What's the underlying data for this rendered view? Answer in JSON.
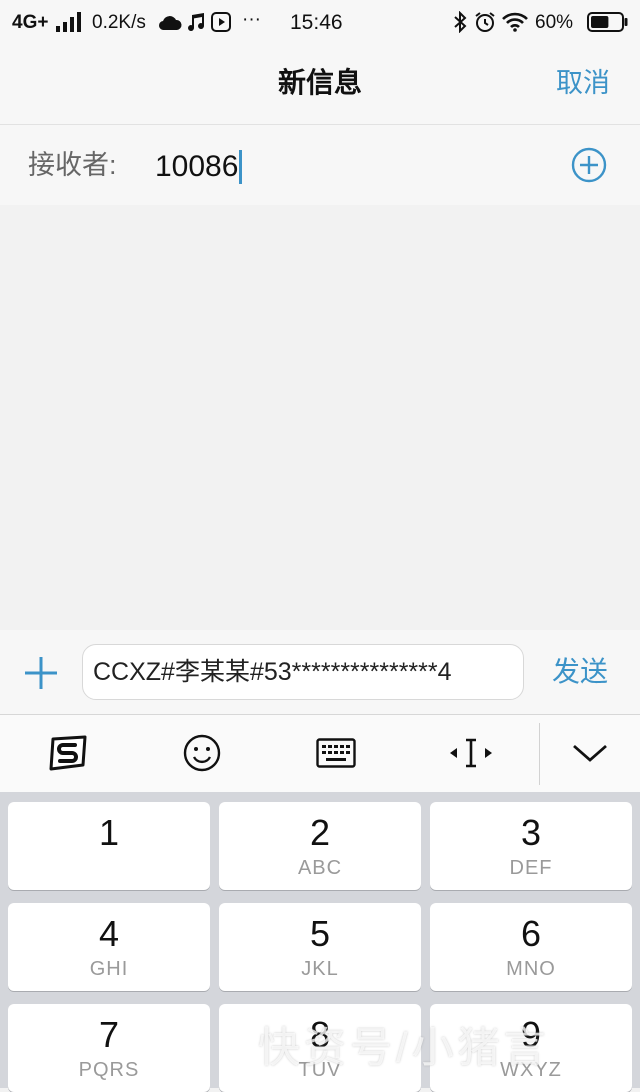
{
  "status_bar": {
    "network": "4G+",
    "speed": "0.2K/s",
    "more": "···",
    "time": "15:46",
    "battery_percent": "60%",
    "battery_level": 0.6,
    "icons": [
      "signal-icon",
      "cloud-icon",
      "music-icon",
      "play-icon",
      "bluetooth-icon",
      "alarm-icon",
      "wifi-icon",
      "battery-icon"
    ]
  },
  "nav": {
    "title": "新信息",
    "cancel_label": "取消"
  },
  "recipient": {
    "label": "接收者:",
    "value": "10086"
  },
  "compose": {
    "message": "CCXZ#李某某#53***************4",
    "send_label": "发送"
  },
  "keyboard_toolbar": {
    "icons": [
      "sogou-logo-icon",
      "emoji-icon",
      "keyboard-icon",
      "cursor-move-icon",
      "chevron-down-icon"
    ]
  },
  "keypad": {
    "keys": [
      {
        "digit": "1",
        "letters": ""
      },
      {
        "digit": "2",
        "letters": "ABC"
      },
      {
        "digit": "3",
        "letters": "DEF"
      },
      {
        "digit": "4",
        "letters": "GHI"
      },
      {
        "digit": "5",
        "letters": "JKL"
      },
      {
        "digit": "6",
        "letters": "MNO"
      },
      {
        "digit": "7",
        "letters": "PQRS"
      },
      {
        "digit": "8",
        "letters": "TUV"
      },
      {
        "digit": "9",
        "letters": "WXYZ"
      }
    ]
  },
  "watermark": "快资号/小猪言",
  "colors": {
    "accent": "#3c93c8",
    "background": "#f2f2f2",
    "keypad_bg": "#d4d6db"
  }
}
